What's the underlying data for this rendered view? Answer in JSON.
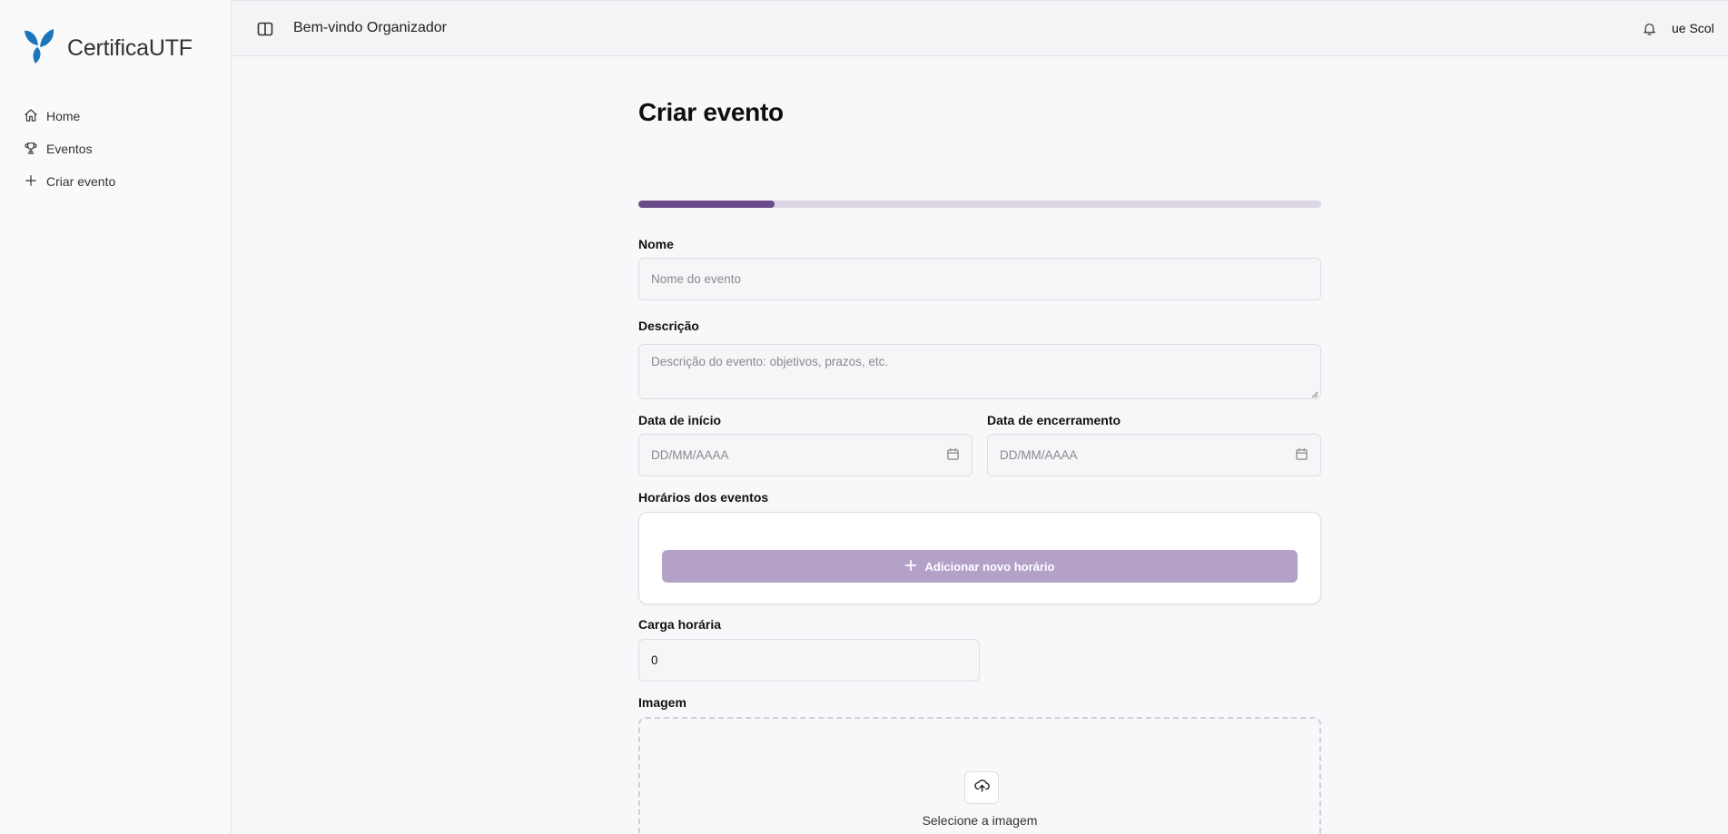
{
  "app": {
    "name": "CertificaUTF",
    "brand_color": "#1b75bb"
  },
  "sidebar": {
    "items": [
      {
        "label": "Home",
        "icon": "home-icon"
      },
      {
        "label": "Eventos",
        "icon": "trophy-icon"
      },
      {
        "label": "Criar evento",
        "icon": "plus-icon"
      }
    ]
  },
  "header": {
    "welcome": "Bem-vindo Organizador",
    "user_name_visible": "ue Scol",
    "icons": [
      "sidebar-toggle-icon",
      "bell-icon"
    ]
  },
  "form": {
    "title": "Criar evento",
    "progress": 0.2,
    "accent_color": "#6b4a8a",
    "fields": {
      "nome": {
        "label": "Nome",
        "placeholder": "Nome do evento"
      },
      "descricao": {
        "label": "Descrição",
        "placeholder": "Descrição do evento: objetivos, prazos, etc."
      },
      "data_inicio": {
        "label": "Data de início",
        "placeholder": "DD/MM/AAAA"
      },
      "data_encerramento": {
        "label": "Data de encerramento",
        "placeholder": "DD/MM/AAAA"
      },
      "horarios": {
        "label": "Horários dos eventos",
        "add_button": "Adicionar novo horário"
      },
      "carga_horaria": {
        "label": "Carga horária",
        "value": "0"
      },
      "imagem": {
        "label": "Imagem",
        "upload_text": "Selecione a imagem"
      }
    }
  }
}
